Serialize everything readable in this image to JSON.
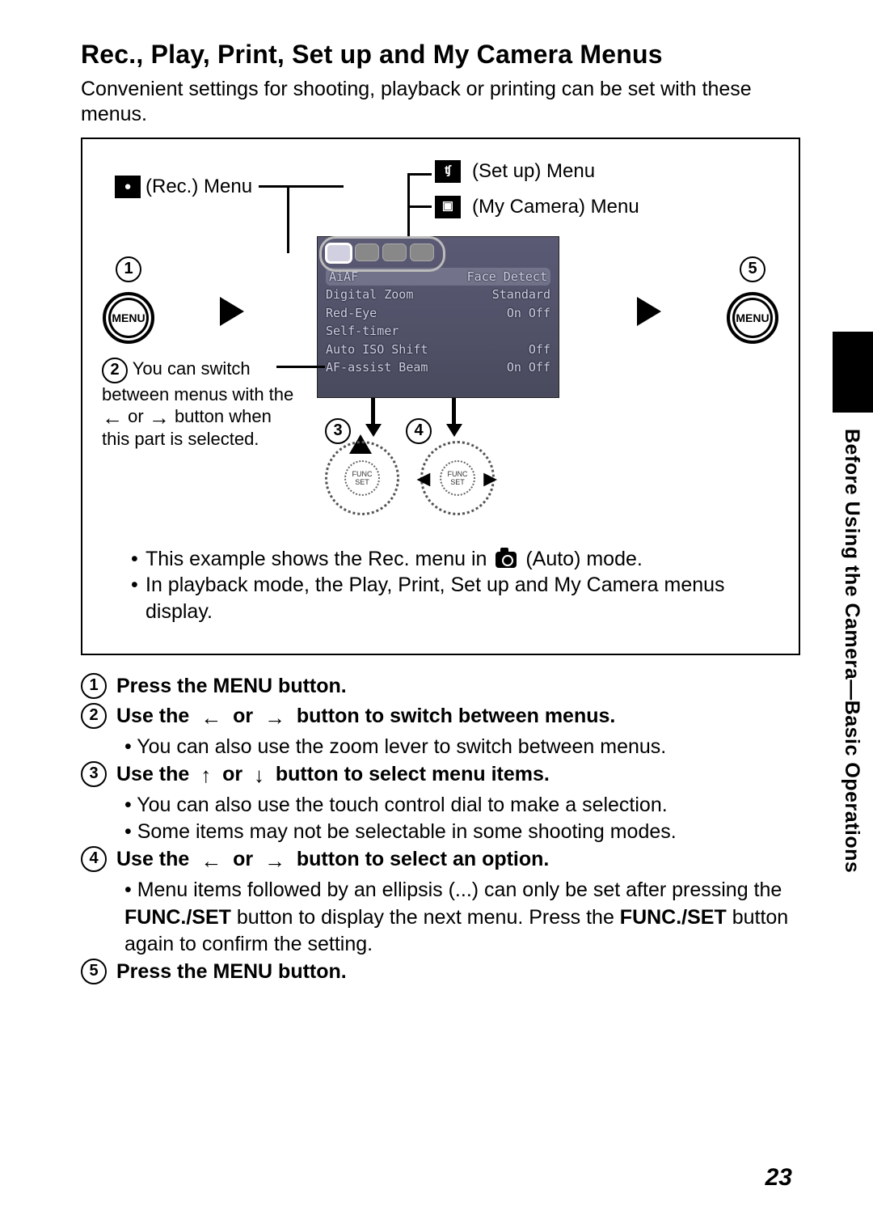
{
  "title": "Rec., Play, Print, Set up and My Camera Menus",
  "intro": "Convenient settings for shooting, playback or printing can be set with these menus.",
  "legend": {
    "rec": "(Rec.) Menu",
    "setup": "(Set up) Menu",
    "mycamera": "(My Camera) Menu"
  },
  "step2_text_a": "You can switch between menus with the",
  "step2_text_b": "or",
  "step2_text_c": "button when this part is selected.",
  "lcd": {
    "rows": [
      {
        "label": "AiAF",
        "value": "Face Detect"
      },
      {
        "label": "Digital Zoom",
        "value": "Standard"
      },
      {
        "label": "Red-Eye",
        "value": "On Off"
      },
      {
        "label": "Self-timer",
        "value": ""
      },
      {
        "label": "Auto ISO Shift",
        "value": "Off"
      },
      {
        "label": "AF-assist Beam",
        "value": "On Off"
      }
    ]
  },
  "box_notes": {
    "note1a": "This example shows the Rec. menu in",
    "note1b": "(Auto) mode.",
    "note2": "In playback mode, the Play, Print, Set up and My Camera menus display."
  },
  "menu_label": "MENU",
  "steps": {
    "s1": "Press the MENU button.",
    "s2": "Use the  ←  or  →  button to switch between menus.",
    "s2_sub1": "You can also use the zoom lever to switch between menus.",
    "s3": "Use the  ↑  or  ↓  button to select menu items.",
    "s3_sub1": "You can also use the touch control dial to make a selection.",
    "s3_sub2": "Some items may not be selectable in some shooting modes.",
    "s4": "Use the  ←  or  →  button to select an option.",
    "s4_sub1a": "Menu items followed by an ellipsis (...) can only be set after pressing the ",
    "s4_sub1b": " button to display the next menu. Press the ",
    "s4_sub1c": " button again to confirm the setting.",
    "funcset": "FUNC./SET",
    "s5": "Press the MENU button."
  },
  "side_label": "Before Using the Camera—Basic Operations",
  "page_number": "23"
}
